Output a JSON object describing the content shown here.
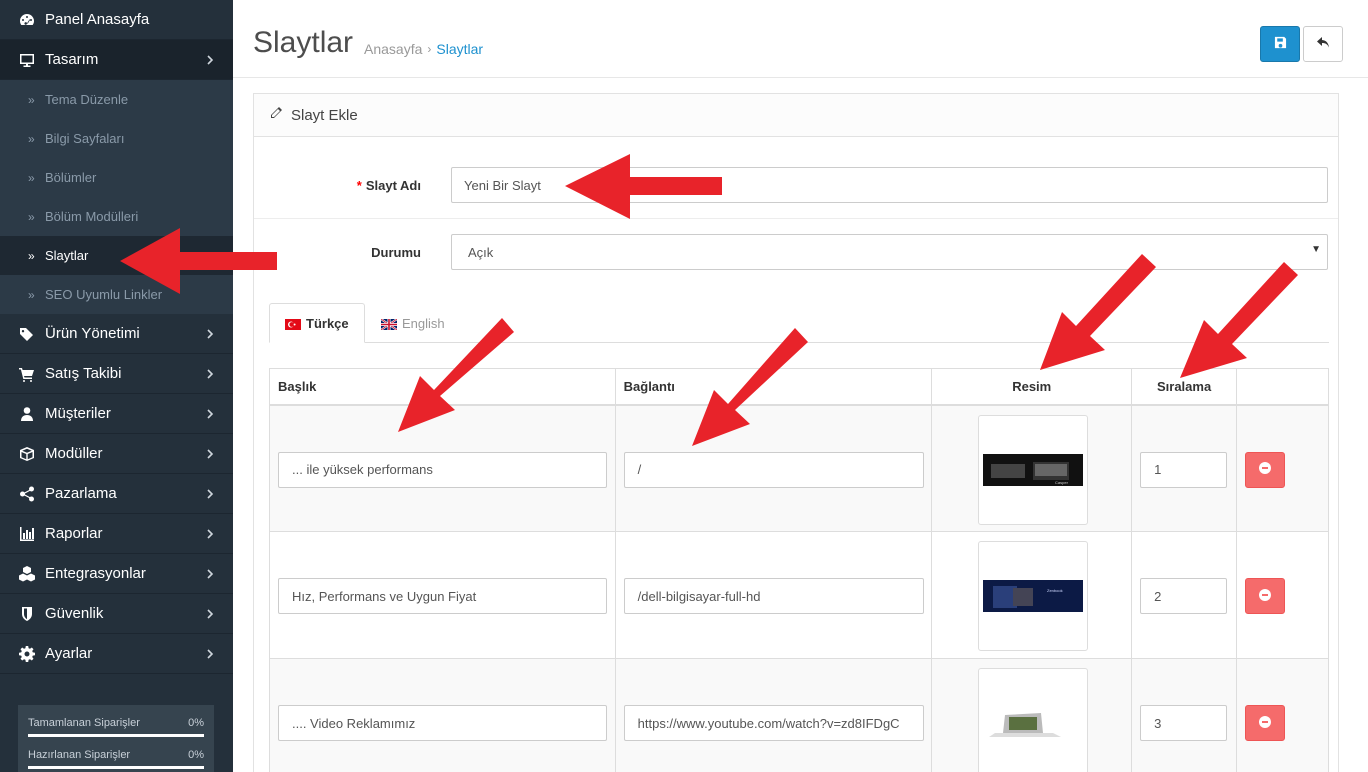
{
  "sidebar": {
    "items": [
      {
        "label": "Panel Anasayfa",
        "icon": "dashboard-icon"
      },
      {
        "label": "Tasarım",
        "icon": "monitor-icon"
      },
      {
        "label": "Ürün Yönetimi",
        "icon": "tags-icon"
      },
      {
        "label": "Satış Takibi",
        "icon": "cart-icon"
      },
      {
        "label": "Müşteriler",
        "icon": "user-icon"
      },
      {
        "label": "Modüller",
        "icon": "cube-icon"
      },
      {
        "label": "Pazarlama",
        "icon": "share-icon"
      },
      {
        "label": "Raporlar",
        "icon": "bar-chart-icon"
      },
      {
        "label": "Entegrasyonlar",
        "icon": "cubes-icon"
      },
      {
        "label": "Güvenlik",
        "icon": "shield-icon"
      },
      {
        "label": "Ayarlar",
        "icon": "gear-icon"
      }
    ],
    "sub_items": [
      "Tema Düzenle",
      "Bilgi Sayfaları",
      "Bölümler",
      "Bölüm Modülleri",
      "Slaytlar",
      "SEO Uyumlu Linkler"
    ],
    "active_sub": "Slaytlar",
    "stats": [
      {
        "label": "Tamamlanan Siparişler",
        "value": "0%"
      },
      {
        "label": "Hazırlanan Siparişler",
        "value": "0%"
      }
    ]
  },
  "header": {
    "title": "Slaytlar",
    "breadcrumb": {
      "home": "Anasayfa",
      "separator": "›",
      "current": "Slaytlar"
    }
  },
  "panel": {
    "heading": "Slayt Ekle",
    "name_label": "Slayt Adı",
    "required_mark": "*",
    "name_value": "Yeni Bir Slayt",
    "status_label": "Durumu",
    "status_value": "Açık",
    "tabs": [
      {
        "label": "Türkçe",
        "active": true
      },
      {
        "label": "English",
        "active": false
      }
    ],
    "columns": [
      "Başlık",
      "Bağlantı",
      "Resim",
      "Sıralama"
    ],
    "rows": [
      {
        "title": "... ile yüksek performans",
        "link": "/",
        "order": "1",
        "thumb": "slide-image-1"
      },
      {
        "title": "Hız, Performans ve Uygun Fiyat",
        "link": "/dell-bilgisayar-full-hd",
        "order": "2",
        "thumb": "slide-image-2"
      },
      {
        "title": ".... Video Reklamımız",
        "link": "https://www.youtube.com/watch?v=zd8IFDgC",
        "order": "3",
        "thumb": "slide-image-3"
      }
    ]
  },
  "colors": {
    "sidebar_bg": "#24303b",
    "primary": "#1e91cf",
    "danger": "#f56b6b",
    "annotation_arrow": "#e8232a"
  }
}
